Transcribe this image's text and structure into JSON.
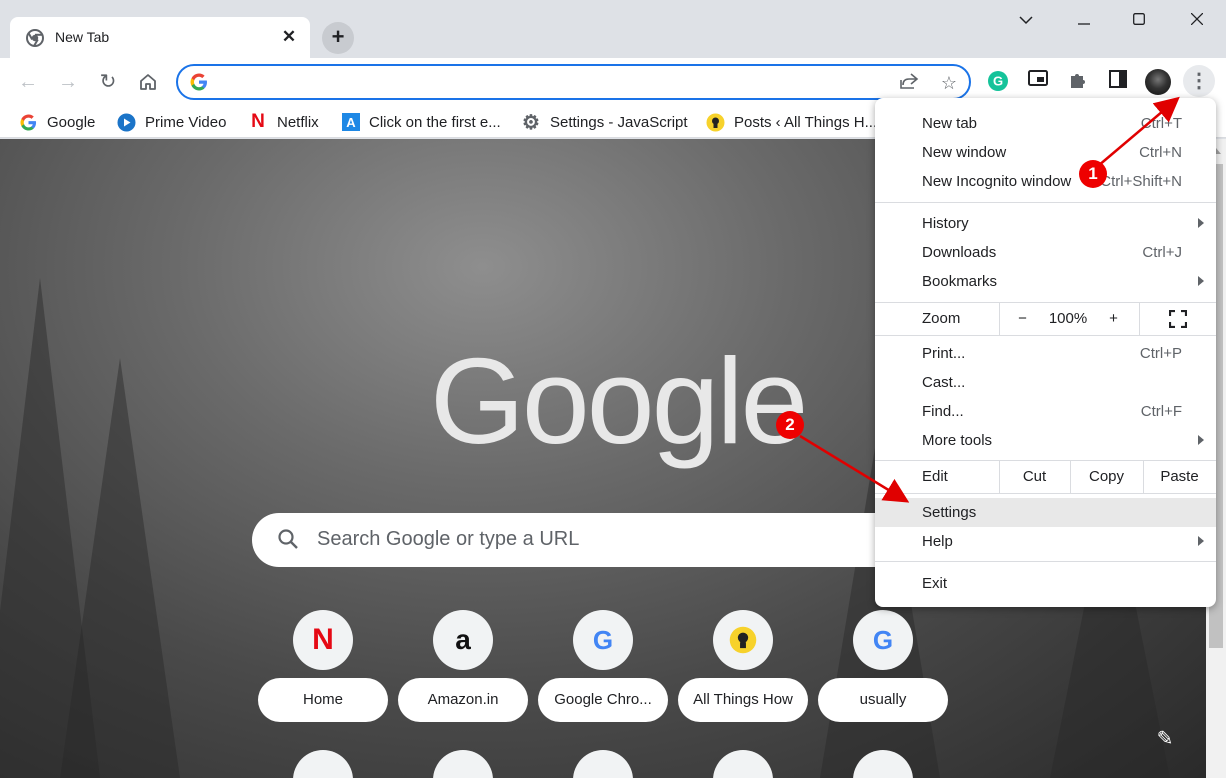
{
  "tab": {
    "title": "New Tab"
  },
  "omnibox": {
    "value": ""
  },
  "bookmarks": [
    {
      "label": "Google"
    },
    {
      "label": "Prime Video"
    },
    {
      "label": "Netflix"
    },
    {
      "label": "Click on the first e..."
    },
    {
      "label": "Settings - JavaScript"
    },
    {
      "label": "Posts ‹ All Things H..."
    }
  ],
  "ntp": {
    "logo": "Google",
    "search_placeholder": "Search Google or type a URL",
    "shortcuts": [
      {
        "label": "Home",
        "icon": "N"
      },
      {
        "label": "Amazon.in",
        "icon": "a"
      },
      {
        "label": "Google Chro...",
        "icon": "G"
      },
      {
        "label": "All Things How",
        "icon": "bulb"
      },
      {
        "label": "usually",
        "icon": "G"
      }
    ]
  },
  "menu": {
    "new_tab": {
      "label": "New tab",
      "shortcut": "Ctrl+T"
    },
    "new_window": {
      "label": "New window",
      "shortcut": "Ctrl+N"
    },
    "new_incognito": {
      "label": "New Incognito window",
      "shortcut": "Ctrl+Shift+N"
    },
    "history": {
      "label": "History"
    },
    "downloads": {
      "label": "Downloads",
      "shortcut": "Ctrl+J"
    },
    "bookmarks": {
      "label": "Bookmarks"
    },
    "zoom": {
      "label": "Zoom",
      "minus": "−",
      "value": "100%",
      "plus": "+"
    },
    "print": {
      "label": "Print...",
      "shortcut": "Ctrl+P"
    },
    "cast": {
      "label": "Cast..."
    },
    "find": {
      "label": "Find...",
      "shortcut": "Ctrl+F"
    },
    "more_tools": {
      "label": "More tools"
    },
    "edit": {
      "label": "Edit",
      "cut": "Cut",
      "copy": "Copy",
      "paste": "Paste"
    },
    "settings": {
      "label": "Settings"
    },
    "help": {
      "label": "Help"
    },
    "exit": {
      "label": "Exit"
    }
  },
  "annotations": {
    "step1": "1",
    "step2": "2"
  },
  "colors": {
    "accent": "#1a73e8",
    "annotation": "#e00000",
    "menu_highlight": "#e8e8e8"
  }
}
